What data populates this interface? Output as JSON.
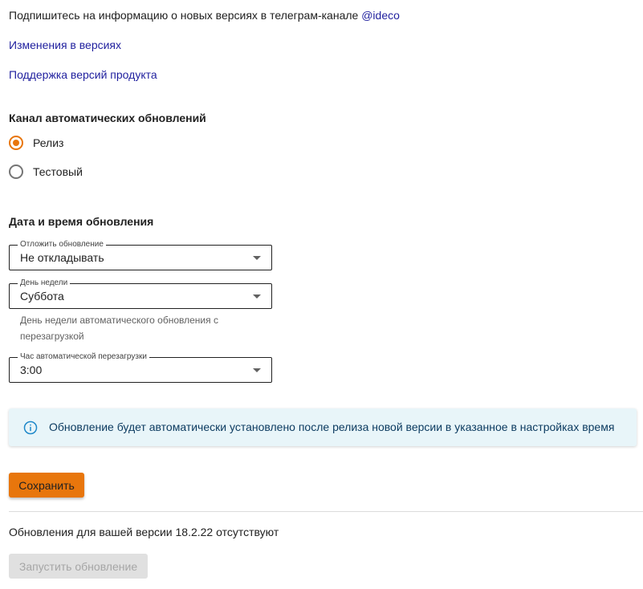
{
  "telegram": {
    "prefix": "Подпишитесь на информацию о новых версиях в телеграм-канале ",
    "channel": "@ideco"
  },
  "links": {
    "changes": "Изменения в версиях",
    "support": "Поддержка версий продукта"
  },
  "channel_section": {
    "title": "Канал автоматических обновлений",
    "options": [
      {
        "label": "Релиз",
        "checked": true
      },
      {
        "label": "Тестовый",
        "checked": false
      }
    ]
  },
  "schedule_section": {
    "title": "Дата и время обновления",
    "postpone": {
      "label": "Отложить обновление",
      "value": "Не откладывать"
    },
    "weekday": {
      "label": "День недели",
      "value": "Суббота",
      "helper_line1": "День недели автоматического обновления с",
      "helper_line2": "перезагрузкой"
    },
    "hour": {
      "label": "Час автоматической перезагрузки",
      "value": "3:00"
    }
  },
  "info": {
    "icon": "info-icon",
    "text": "Обновление будет автоматически установлено после релиза новой версии в указанное в настройках время"
  },
  "actions": {
    "save_label": "Сохранить",
    "status_text": "Обновления для вашей версии 18.2.22 отсутствуют",
    "run_update_label": "Запустить обновление"
  },
  "colors": {
    "accent": "#e8760c",
    "link": "#1f1f9e",
    "info_bg": "#e8f5f9",
    "info_icon": "#1e88c9"
  }
}
